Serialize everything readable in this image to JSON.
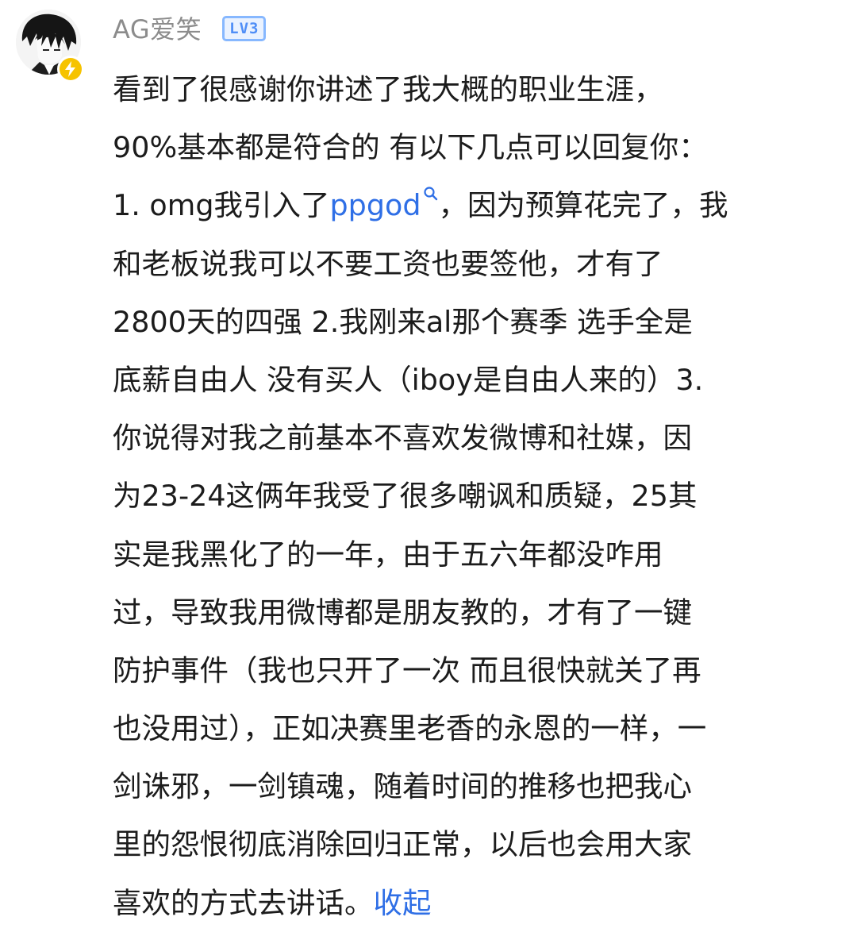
{
  "comment": {
    "author": {
      "name": "AG爱笑",
      "level": "LV3",
      "avatar_icon": "anime-avatar",
      "verified_icon": "lightning-verified-icon"
    },
    "lines": [
      {
        "text": "看到了很感谢你讲述了我大概的职业生涯，"
      },
      {
        "text": "90%基本都是符合的 有以下几点可以回复你："
      },
      {
        "before": "1. omg我引入了",
        "link": "ppgod",
        "after": "，因为预算花完了，我"
      },
      {
        "text": "和老板说我可以不要工资也要签他，才有了"
      },
      {
        "text": "2800天的四强 2.我刚来al那个赛季 选手全是"
      },
      {
        "text": "底薪自由人 没有买人（iboy是自由人来的）3."
      },
      {
        "text": "你说得对我之前基本不喜欢发微博和社媒，因"
      },
      {
        "text": "为23-24这俩年我受了很多嘲讽和质疑，25其"
      },
      {
        "text": "实是我黑化了的一年，由于五六年都没咋用"
      },
      {
        "text": "过，导致我用微博都是朋友教的，才有了一键"
      },
      {
        "text": "防护事件（我也只开了一次 而且很快就关了再"
      },
      {
        "text": "也没用过），正如决赛里老香的永恩的一样，一"
      },
      {
        "text": "剑诛邪，一剑镇魂，随着时间的推移也把我心"
      },
      {
        "text": "里的怨恨彻底消除回归正常，以后也会用大家"
      },
      {
        "before": "喜欢的方式去讲话。",
        "collapse": "收起"
      }
    ]
  },
  "colors": {
    "link": "#2f6fe6",
    "username": "#8c8c8c",
    "text": "#1c1c1c",
    "level_badge": "#4f8ef7",
    "verified": "#f6c300"
  }
}
